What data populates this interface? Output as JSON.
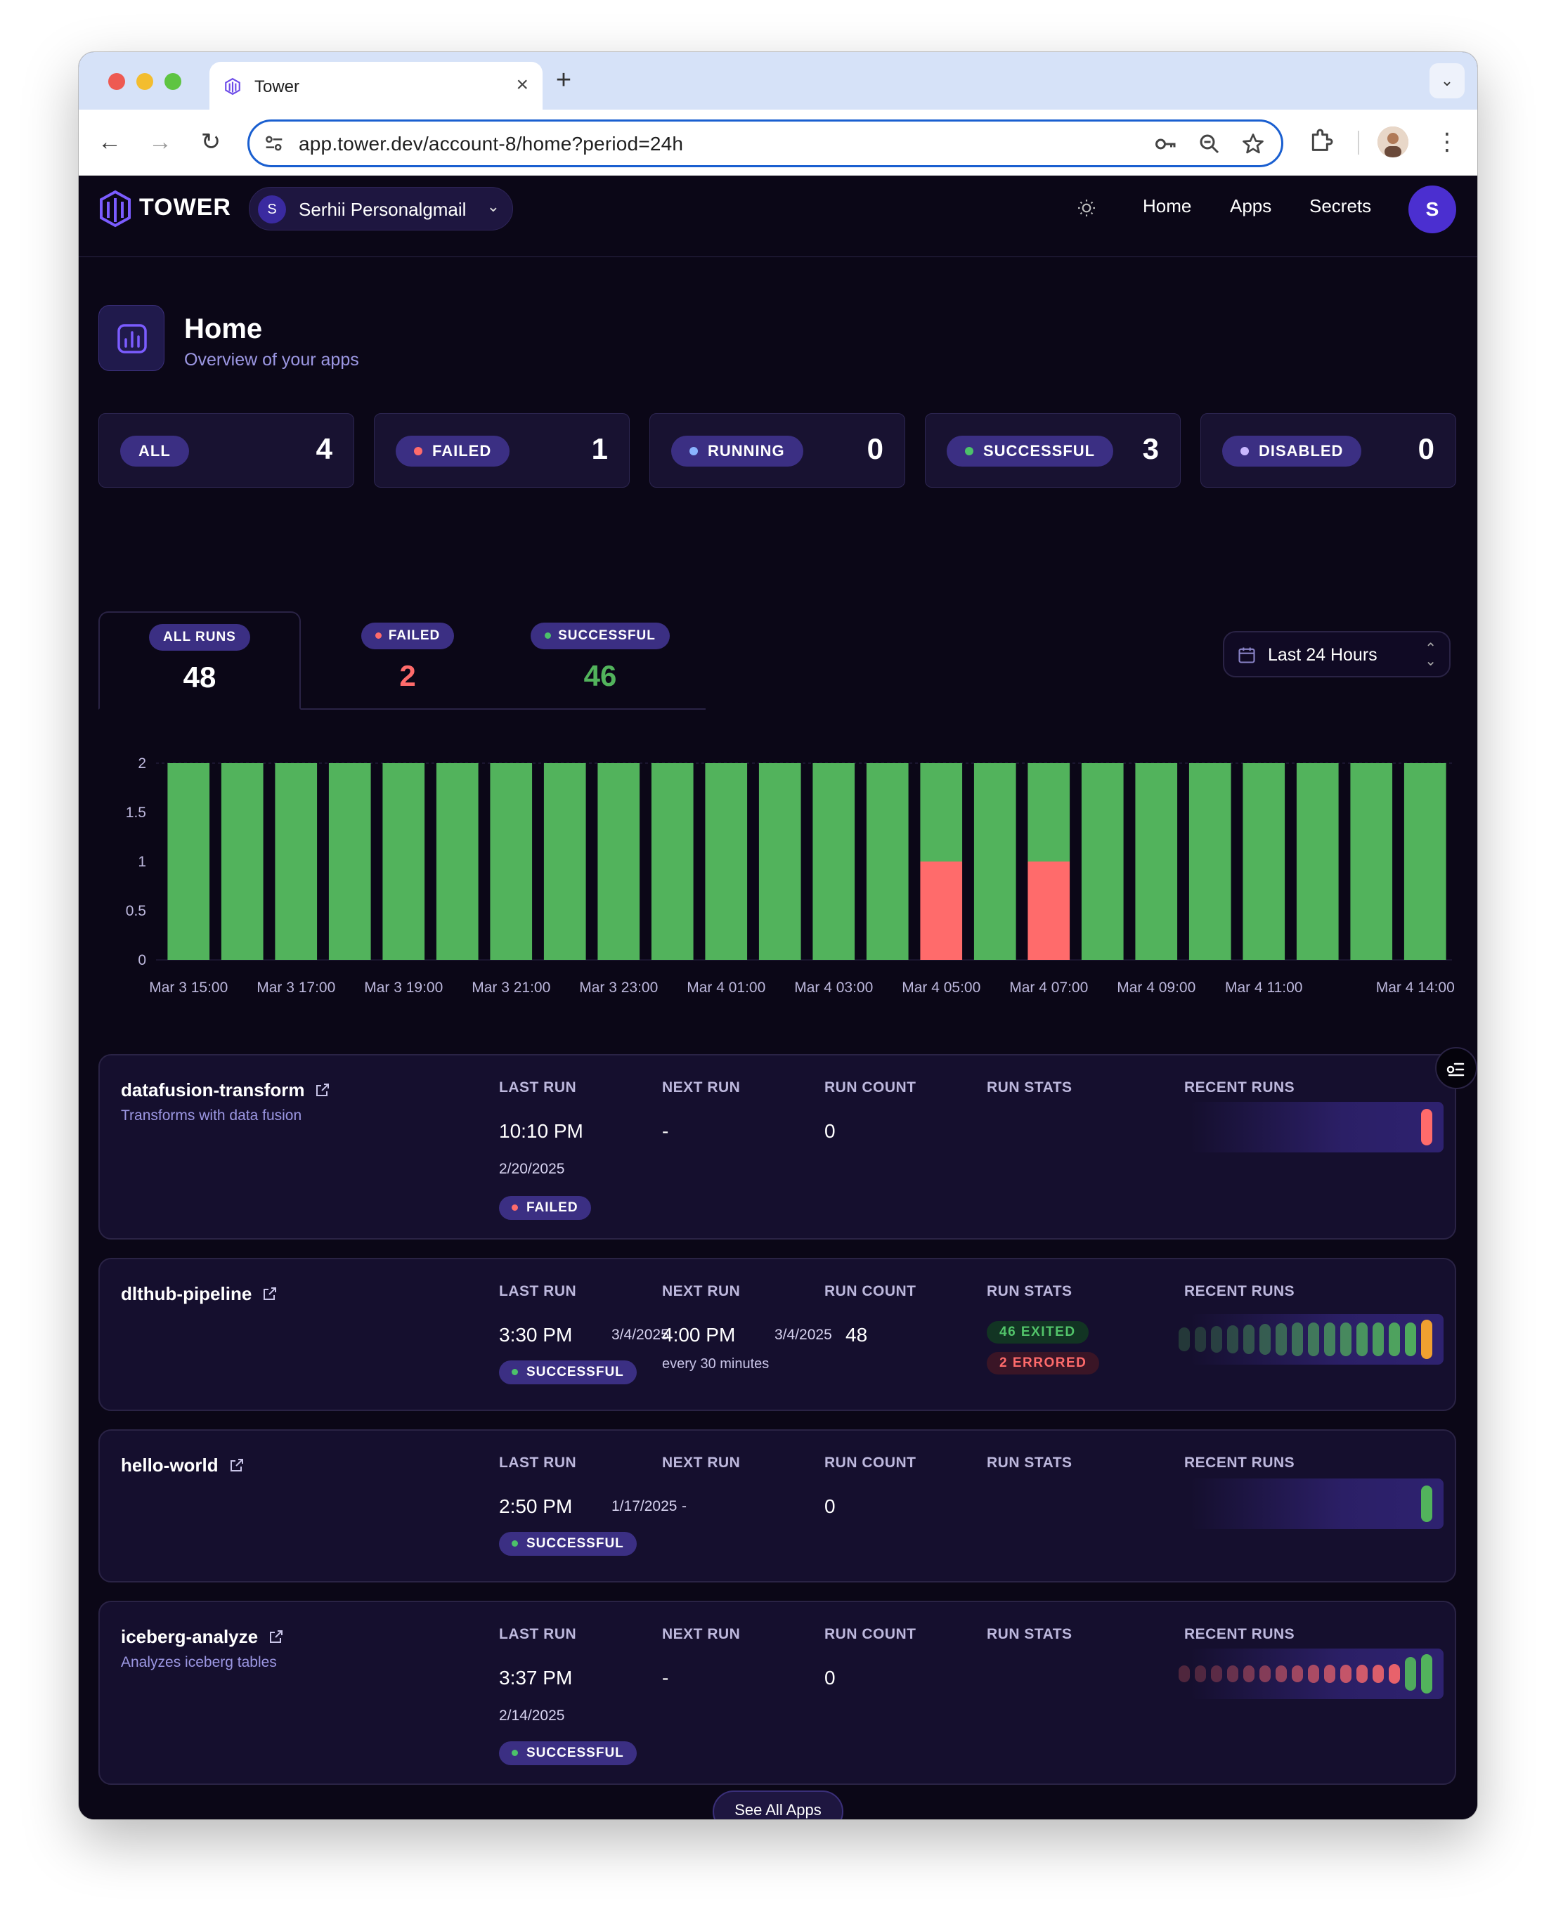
{
  "browser": {
    "tab_title": "Tower",
    "url": "app.tower.dev/account-8/home?period=24h"
  },
  "nav": {
    "brand": "TOWER",
    "account_initial": "S",
    "account_name": "Serhii Personalgmail",
    "links": {
      "home": "Home",
      "apps": "Apps",
      "secrets": "Secrets"
    },
    "user_initial": "S"
  },
  "page": {
    "title": "Home",
    "subtitle": "Overview of your apps"
  },
  "stats": [
    {
      "label": "ALL",
      "count": "4",
      "dot": ""
    },
    {
      "label": "FAILED",
      "count": "1",
      "dot": "#ff6b6b"
    },
    {
      "label": "RUNNING",
      "count": "0",
      "dot": "#8ab4ff"
    },
    {
      "label": "SUCCESSFUL",
      "count": "3",
      "dot": "#4cc26a"
    },
    {
      "label": "DISABLED",
      "count": "0",
      "dot": "#c9b8ff"
    }
  ],
  "runs_tabs": {
    "all": {
      "label": "ALL RUNS",
      "count": "48"
    },
    "failed": {
      "label": "FAILED",
      "count": "2"
    },
    "successful": {
      "label": "SUCCESSFUL",
      "count": "46"
    }
  },
  "period": {
    "label": "Last 24 Hours"
  },
  "colors": {
    "success": "#52b35c",
    "failed": "#ff6b6b",
    "accent": "#3b2f83",
    "background": "#0b0717"
  },
  "chart_data": {
    "type": "bar",
    "stacked": true,
    "ylim": [
      0,
      2
    ],
    "y_ticks": [
      "0",
      "0.5",
      "1",
      "1.5",
      "2"
    ],
    "x_tick_labels": [
      "Mar 3 15:00",
      "Mar 3 17:00",
      "Mar 3 19:00",
      "Mar 3 21:00",
      "Mar 3 23:00",
      "Mar 4 01:00",
      "Mar 4 03:00",
      "Mar 4 05:00",
      "Mar 4 07:00",
      "Mar 4 09:00",
      "Mar 4 11:00",
      "Mar 4 14:00"
    ],
    "series": [
      {
        "name": "Failed",
        "color": "#ff6b6b",
        "values": [
          0,
          0,
          0,
          0,
          0,
          0,
          0,
          0,
          0,
          0,
          0,
          0,
          0,
          0,
          1,
          0,
          1,
          0,
          0,
          0,
          0,
          0,
          0,
          0
        ]
      },
      {
        "name": "Successful",
        "color": "#52b35c",
        "values": [
          2,
          2,
          2,
          2,
          2,
          2,
          2,
          2,
          2,
          2,
          2,
          2,
          2,
          2,
          1,
          2,
          1,
          2,
          2,
          2,
          2,
          2,
          2,
          2
        ]
      }
    ],
    "grid": false,
    "legend": "none"
  },
  "table_headers": {
    "last_run": "LAST RUN",
    "next_run": "NEXT RUN",
    "run_count": "RUN COUNT",
    "run_stats": "RUN STATS",
    "recent_runs": "RECENT RUNS"
  },
  "apps": [
    {
      "name": "datafusion-transform",
      "description": "Transforms with data fusion",
      "last_run_time": "10:10 PM",
      "last_run_date": "2/20/2025",
      "last_status": "FAILED",
      "next_run": "-",
      "run_count": "0",
      "recent_runs": [
        "failed"
      ]
    },
    {
      "name": "dlthub-pipeline",
      "description": "",
      "last_run_time": "3:30 PM",
      "last_run_date": "3/4/2025",
      "last_status": "SUCCESSFUL",
      "next_run": "4:00 PM",
      "next_run_date": "3/4/2025",
      "next_run_schedule": "every 30 minutes",
      "run_count": "48",
      "run_stats": {
        "exited": "46 EXITED",
        "errored": "2 ERRORED"
      },
      "recent_runs": [
        "success",
        "success",
        "success",
        "success",
        "success",
        "success",
        "success",
        "success",
        "success",
        "success",
        "success",
        "success",
        "success",
        "success",
        "success",
        "running"
      ]
    },
    {
      "name": "hello-world",
      "description": "",
      "last_run_time": "2:50 PM",
      "last_run_date": "1/17/2025",
      "last_status": "SUCCESSFUL",
      "next_run": "-",
      "run_count": "0",
      "recent_runs": [
        "success"
      ]
    },
    {
      "name": "iceberg-analyze",
      "description": "Analyzes iceberg tables",
      "last_run_time": "3:37 PM",
      "last_run_date": "2/14/2025",
      "last_status": "SUCCESSFUL",
      "next_run": "-",
      "run_count": "0",
      "recent_runs": [
        "failed",
        "failed",
        "failed",
        "failed",
        "failed",
        "failed",
        "failed",
        "failed",
        "failed",
        "failed",
        "failed",
        "failed",
        "failed",
        "failed",
        "success",
        "success"
      ]
    }
  ],
  "see_all": "See All Apps"
}
